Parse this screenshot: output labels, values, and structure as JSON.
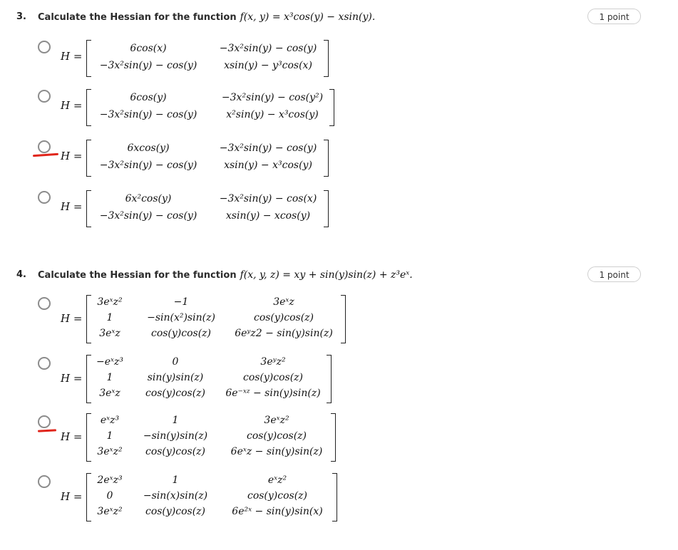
{
  "questions": [
    {
      "number": "3.",
      "text": "Calculate the Hessian for the function",
      "function": "f(x, y) = x³cos(y) − xsin(y).",
      "points": "1 point",
      "h_label": "H =",
      "options": [
        {
          "rows": [
            [
              "6cos(x)",
              "−3x²sin(y) − cos(y)"
            ],
            [
              "−3x²sin(y) − cos(y)",
              "xsin(y) − y³cos(x)"
            ]
          ],
          "marked": false
        },
        {
          "rows": [
            [
              "6cos(y)",
              "−3x²sin(y) − cos(y²)"
            ],
            [
              "−3x²sin(y) − cos(y)",
              "x²sin(y) − x³cos(y)"
            ]
          ],
          "marked": false
        },
        {
          "rows": [
            [
              "6xcos(y)",
              "−3x²sin(y) − cos(y)"
            ],
            [
              "−3x²sin(y) − cos(y)",
              "xsin(y) − x³cos(y)"
            ]
          ],
          "marked": true
        },
        {
          "rows": [
            [
              "6x²cos(y)",
              "−3x²sin(y) − cos(x)"
            ],
            [
              "−3x²sin(y) − cos(y)",
              "xsin(y) − xcos(y)"
            ]
          ],
          "marked": false
        }
      ]
    },
    {
      "number": "4.",
      "text": "Calculate the Hessian for the function",
      "function": "f(x, y, z) = xy + sin(y)sin(z) + z³eˣ.",
      "points": "1 point",
      "h_label": "H =",
      "options": [
        {
          "rows": [
            [
              "3eˣz²",
              "−1",
              "3eˣz"
            ],
            [
              "1",
              "−sin(x²)sin(z)",
              "cos(y)cos(z)"
            ],
            [
              "3eˣz",
              "cos(y)cos(z)",
              "6eʸz2 − sin(y)sin(z)"
            ]
          ],
          "marked": false
        },
        {
          "rows": [
            [
              "−eˣz³",
              "0",
              "3eʸz²"
            ],
            [
              "1",
              "sin(y)sin(z)",
              "cos(y)cos(z)"
            ],
            [
              "3eˣz",
              "cos(y)cos(z)",
              "6e⁻ˣᶻ − sin(y)sin(z)"
            ]
          ],
          "marked": false
        },
        {
          "rows": [
            [
              "eˣz³",
              "1",
              "3eˣz²"
            ],
            [
              "1",
              "−sin(y)sin(z)",
              "cos(y)cos(z)"
            ],
            [
              "3eˣz²",
              "cos(y)cos(z)",
              "6eˣz − sin(y)sin(z)"
            ]
          ],
          "marked": true
        },
        {
          "rows": [
            [
              "2eˣz³",
              "1",
              "eˣz²"
            ],
            [
              "0",
              "−sin(x)sin(z)",
              "cos(y)cos(z)"
            ],
            [
              "3eˣz²",
              "cos(y)cos(z)",
              "6e²ˣ − sin(y)sin(x)"
            ]
          ],
          "marked": false
        }
      ]
    }
  ],
  "colors": {
    "annotation_mark": "#e0251b",
    "radio_border": "#8c8c8c"
  }
}
